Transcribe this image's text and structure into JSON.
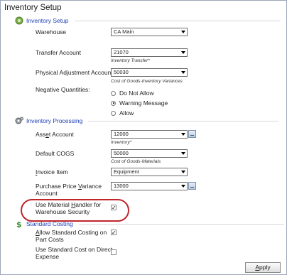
{
  "title": "Inventory Setup",
  "sections": {
    "inventory_setup": {
      "label": "Inventory Setup",
      "icon": "gear-globe-icon"
    },
    "inventory_processing": {
      "label": "Inventory Processing",
      "icon": "gears-icon"
    },
    "standard_costing": {
      "label": "Standard Costing",
      "icon": "dollar-icon"
    }
  },
  "fields": {
    "warehouse": {
      "label": "Warehouse",
      "value": "CA Main"
    },
    "transfer_account": {
      "label": "Transfer Account",
      "value": "21070",
      "description": "Inventory Transfer*"
    },
    "physical_adjustment_account": {
      "label": "Physical Adjustment Account",
      "value": "50030",
      "description": "Cost of Goods-Inventory Variances"
    },
    "negative_quantities": {
      "label": "Negative Quantities:",
      "options": [
        "Do Not Allow",
        "Warning Message",
        "Allow"
      ],
      "selected": "Warning Message"
    },
    "asset_account": {
      "label": "Asset Account",
      "value": "12000",
      "description": "Inventory*"
    },
    "default_cogs": {
      "label": "Default COGS",
      "value": "50000",
      "description": "Cost of Goods-Materials"
    },
    "invoice_item": {
      "label": "Invoice Item",
      "value": "Equipment"
    },
    "purchase_price_variance": {
      "label_line1": "Purchase Price Variance",
      "label_line2": "Account",
      "value": "13000"
    },
    "use_material_handler": {
      "label_line1": "Use Material Handler for",
      "label_line2": "Warehouse Security",
      "checked": true
    },
    "allow_standard_costing": {
      "label_line1": "Allow Standard Costing on",
      "label_line2": "Part Costs",
      "checked": true
    },
    "use_standard_cost_direct": {
      "label_line1": "Use Standard Cost on Direct",
      "label_line2": "Expense",
      "checked": false
    }
  },
  "apply_label": "Apply",
  "colors": {
    "section_label": "#1f3fb5",
    "highlight_circle": "#c0252a"
  }
}
